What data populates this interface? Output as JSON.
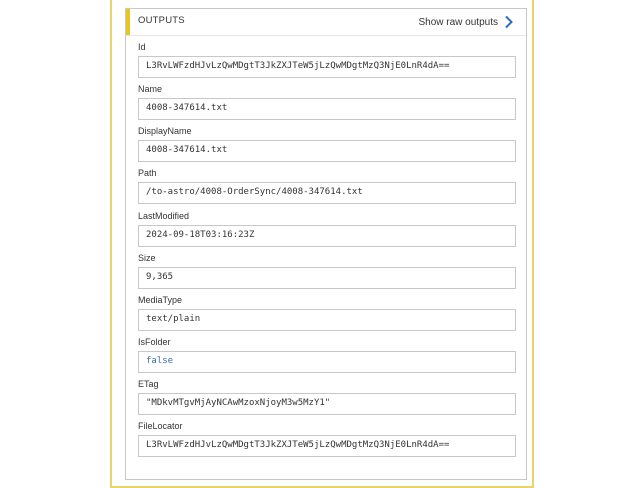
{
  "header": {
    "title": "OUTPUTS",
    "raw_outputs_label": "Show raw outputs",
    "accent_color": "#e8c61c",
    "link_icon": "chevron-right-icon"
  },
  "fields": [
    {
      "label": "Id",
      "value": "L3RvLWFzdHJvLzQwMDgtT3JkZXJTeW5jLzQwMDgtMzQ3NjE0LnR4dA=="
    },
    {
      "label": "Name",
      "value": "4008-347614.txt"
    },
    {
      "label": "DisplayName",
      "value": "4008-347614.txt"
    },
    {
      "label": "Path",
      "value": "/to-astro/4008-OrderSync/4008-347614.txt"
    },
    {
      "label": "LastModified",
      "value": "2024-09-18T03:16:23Z"
    },
    {
      "label": "Size",
      "value": "9,365"
    },
    {
      "label": "MediaType",
      "value": "text/plain"
    },
    {
      "label": "IsFolder",
      "value": "false"
    },
    {
      "label": "ETag",
      "value": "\"MDkvMTgvMjAyNCAwMzoxNjoyM3w5MzY1\""
    },
    {
      "label": "FileLocator",
      "value": "L3RvLWFzdHJvLzQwMDgtT3JkZXJTeW5jLzQwMDgtMzQ3NjE0LnR4dA=="
    }
  ]
}
